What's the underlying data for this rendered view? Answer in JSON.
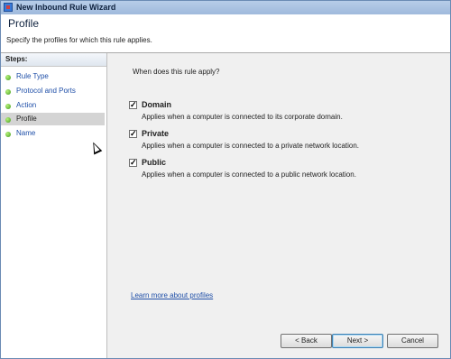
{
  "window": {
    "title": "New Inbound Rule Wizard"
  },
  "header": {
    "title": "Profile",
    "subtitle": "Specify the profiles for which this rule applies."
  },
  "steps": {
    "heading": "Steps:",
    "items": [
      {
        "label": "Rule Type"
      },
      {
        "label": "Protocol and Ports"
      },
      {
        "label": "Action"
      },
      {
        "label": "Profile"
      },
      {
        "label": "Name"
      }
    ],
    "active_index": 3
  },
  "main": {
    "question": "When does this rule apply?",
    "options": [
      {
        "name": "Domain",
        "desc": "Applies when a computer is connected to its corporate domain.",
        "checked": true
      },
      {
        "name": "Private",
        "desc": "Applies when a computer is connected to a private network location.",
        "checked": true
      },
      {
        "name": "Public",
        "desc": "Applies when a computer is connected to a public network location.",
        "checked": true
      }
    ],
    "learn_more": "Learn more about profiles"
  },
  "buttons": {
    "back": "< Back",
    "next": "Next >",
    "cancel": "Cancel"
  },
  "colors": {
    "link": "#1f4fa8",
    "active_step_bg": "#d4d4d4",
    "dialog_bg": "#f0f0f0"
  }
}
